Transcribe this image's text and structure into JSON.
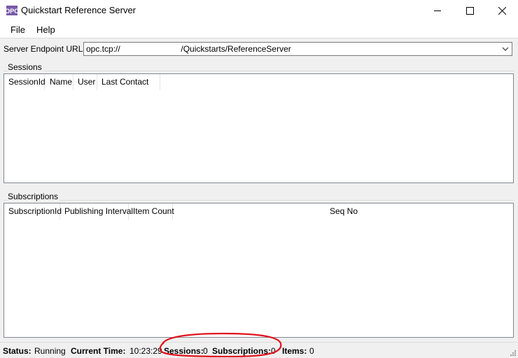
{
  "window": {
    "title": "Quickstart Reference Server",
    "app_icon": "opc-logo-icon"
  },
  "menu": {
    "items": [
      "File",
      "Help"
    ]
  },
  "endpoint": {
    "label": "Server Endpoint URLs",
    "value": "opc.tcp://                          /Quickstarts/ReferenceServer"
  },
  "sessions": {
    "group_label": "Sessions",
    "columns": [
      "SessionId",
      "Name",
      "User",
      "Last Contact"
    ]
  },
  "subscriptions": {
    "group_label": "Subscriptions",
    "columns": [
      "SubscriptionId",
      "Publishing Interval",
      "Item Count",
      "Seq No"
    ]
  },
  "status": {
    "status_label": "Status:",
    "status_value": "Running",
    "time_label": "Current Time:",
    "time_value": "10:23:29",
    "sessions_label": "Sessions:",
    "sessions_value": "0",
    "subscriptions_label": "Subscriptions:",
    "subscriptions_value": "0",
    "items_label": "Items:",
    "items_value": "0"
  },
  "annotation": {
    "color": "#e0141e"
  }
}
